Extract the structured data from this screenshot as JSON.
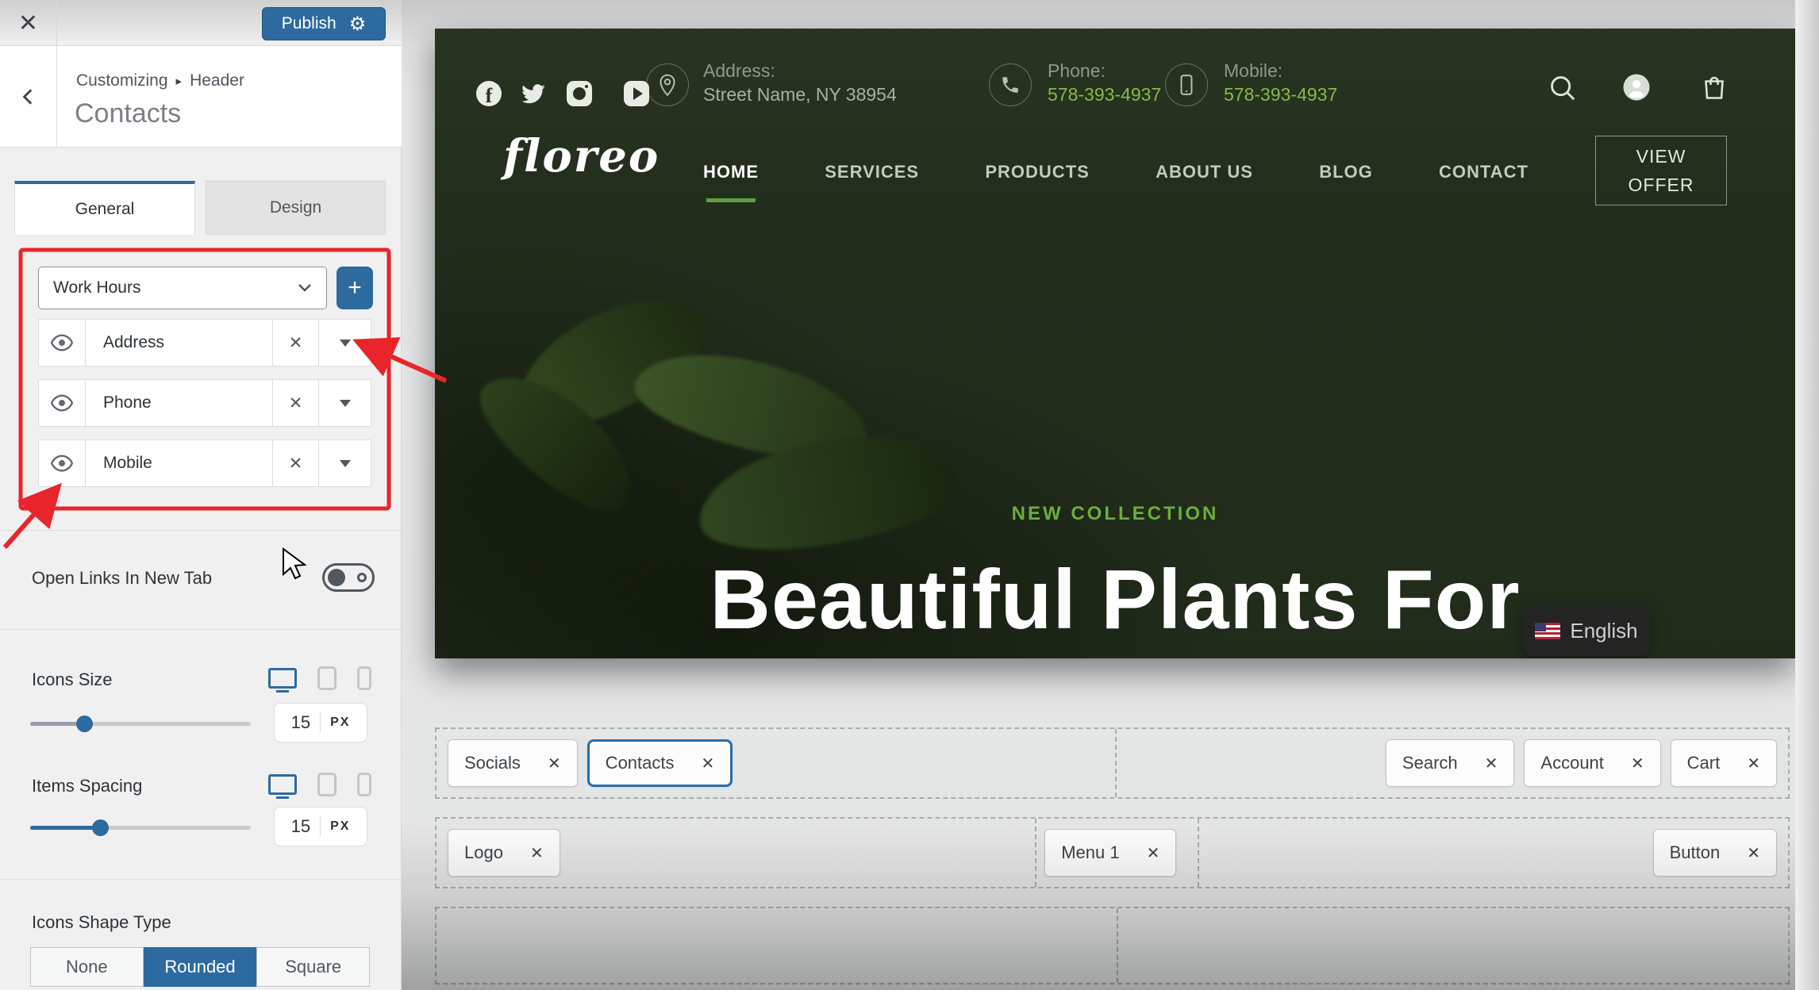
{
  "customizer": {
    "close_glyph": "✕",
    "publish_label": "Publish",
    "gear_glyph": "⚙",
    "breadcrumb": {
      "root": "Customizing",
      "separator": "▸",
      "section": "Header"
    },
    "panel_title": "Contacts",
    "tabs": {
      "general": "General",
      "design": "Design",
      "active": "General"
    },
    "repeater": {
      "select_value": "Work Hours",
      "add_glyph": "+",
      "remove_glyph": "✕",
      "items": [
        {
          "label": "Address"
        },
        {
          "label": "Phone"
        },
        {
          "label": "Mobile"
        }
      ]
    },
    "open_links": {
      "label": "Open Links In New Tab",
      "state": "off"
    },
    "icons_size": {
      "label": "Icons Size",
      "value": "15",
      "unit": "PX",
      "device": "desktop"
    },
    "items_spacing": {
      "label": "Items Spacing",
      "value": "15",
      "unit": "PX",
      "device": "desktop"
    },
    "shape": {
      "label": "Icons Shape Type",
      "options": [
        "None",
        "Rounded",
        "Square"
      ],
      "selected": "Rounded"
    }
  },
  "site": {
    "logo": "floreo",
    "topbar": {
      "social_icons": [
        "facebook",
        "twitter",
        "instagram",
        "youtube"
      ],
      "contacts": [
        {
          "icon": "location-pin",
          "label": "Address:",
          "value": "Street Name, NY 38954"
        },
        {
          "icon": "phone",
          "label": "Phone:",
          "value": "578-393-4937"
        },
        {
          "icon": "mobile",
          "label": "Mobile:",
          "value": "578-393-4937"
        }
      ],
      "utility_icons": [
        "search",
        "account",
        "cart"
      ]
    },
    "menu": [
      {
        "label": "HOME",
        "active": true
      },
      {
        "label": "SERVICES"
      },
      {
        "label": "PRODUCTS"
      },
      {
        "label": "ABOUT US"
      },
      {
        "label": "BLOG"
      },
      {
        "label": "CONTACT"
      }
    ],
    "header_button": "VIEW OFFER",
    "hero": {
      "eyebrow": "NEW COLLECTION",
      "headline": "Beautiful Plants For"
    },
    "language": {
      "label": "English",
      "flag": "us"
    }
  },
  "builder": {
    "close_glyph": "✕",
    "row1": {
      "left": [
        "Socials",
        "Contacts"
      ],
      "selected": "Contacts",
      "right": [
        "Search",
        "Account",
        "Cart"
      ]
    },
    "row2": {
      "cell1": [
        "Logo"
      ],
      "cell2": [
        "Menu 1"
      ],
      "cell3": [
        "Button"
      ]
    },
    "row3": {
      "cell1": [],
      "cell2": []
    }
  },
  "colors": {
    "wp_blue": "#2d6a9f",
    "annotation_red": "#e8252a",
    "site_green_bg": "#212c1b",
    "accent_green": "#6cae3e",
    "value_green": "#86b94a",
    "sidebar_bg": "#f0f0f1"
  }
}
